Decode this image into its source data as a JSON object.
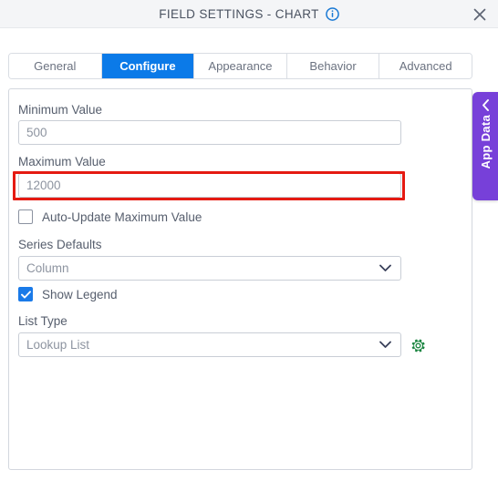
{
  "window": {
    "title": "FIELD SETTINGS - CHART",
    "info_icon": "info-circle-icon",
    "close_icon": "close-icon"
  },
  "tabs": [
    {
      "label": "General",
      "active": false
    },
    {
      "label": "Configure",
      "active": true
    },
    {
      "label": "Appearance",
      "active": false
    },
    {
      "label": "Behavior",
      "active": false
    },
    {
      "label": "Advanced",
      "active": false
    }
  ],
  "form": {
    "minimum_value": {
      "label": "Minimum Value",
      "value": "500",
      "placeholder": "Minimum Value"
    },
    "maximum_value": {
      "label": "Maximum Value",
      "value": "12000",
      "placeholder": "Maximum Value",
      "highlight_color": "#e51a12"
    },
    "auto_update_maximum": {
      "label": "Auto-Update Maximum Value",
      "checked": false
    },
    "series_defaults": {
      "label": "Series Defaults",
      "value": "Column",
      "chevron_icon": "chevron-down-icon"
    },
    "show_legend": {
      "label": "Show Legend",
      "checked": true
    },
    "list_type": {
      "label": "List Type",
      "value": "Lookup List",
      "chevron_icon": "chevron-down-icon",
      "settings_icon": "gear-icon",
      "settings_icon_color": "#19843f"
    }
  },
  "app_data_tab": {
    "label": "App Data",
    "collapse_icon": "chevron-left-icon",
    "color": "#7740d9"
  },
  "colors": {
    "active_tab": "#0b7ae8",
    "checkbox_checked": "#1a7ae8",
    "titlebar_bg": "#f4f5f7"
  }
}
